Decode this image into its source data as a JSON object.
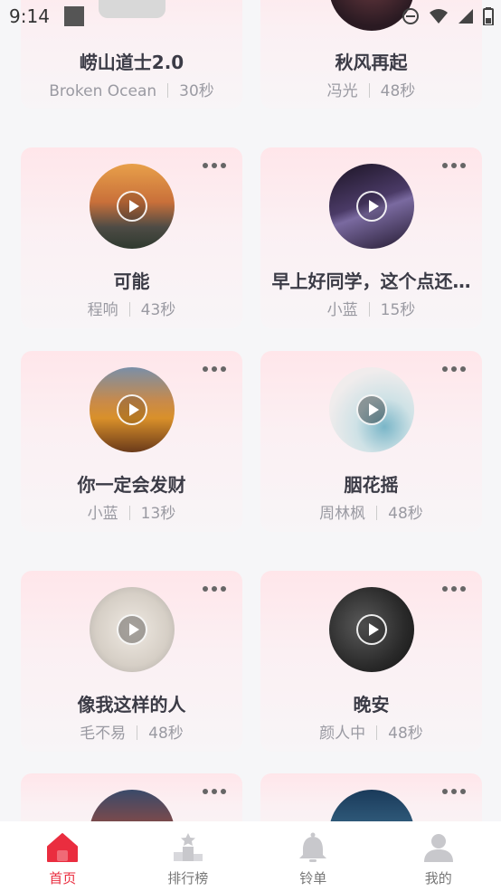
{
  "status_bar": {
    "time": "9:14"
  },
  "cards": [
    {
      "title": "崂山道士2.0",
      "artist": "Broken Ocean",
      "duration": "30秒"
    },
    {
      "title": "秋风再起",
      "artist": "冯光",
      "duration": "48秒"
    },
    {
      "title": "可能",
      "artist": "程响",
      "duration": "43秒"
    },
    {
      "title": "早上好同学，这个点还…",
      "artist": "小蓝",
      "duration": "15秒"
    },
    {
      "title": "你一定会发财",
      "artist": "小蓝",
      "duration": "13秒"
    },
    {
      "title": "胭花摇",
      "artist": "周林枫",
      "duration": "48秒"
    },
    {
      "title": "像我这样的人",
      "artist": "毛不易",
      "duration": "48秒"
    },
    {
      "title": "晚安",
      "artist": "颜人中",
      "duration": "48秒"
    }
  ],
  "tabs": [
    {
      "label": "首页",
      "icon": "home-icon",
      "active": true
    },
    {
      "label": "排行榜",
      "icon": "podium-icon",
      "active": false
    },
    {
      "label": "铃单",
      "icon": "bell-icon",
      "active": false
    },
    {
      "label": "我的",
      "icon": "person-icon",
      "active": false
    }
  ],
  "colors": {
    "accent": "#ea2d3f",
    "card_top": "#ffe6ea"
  }
}
